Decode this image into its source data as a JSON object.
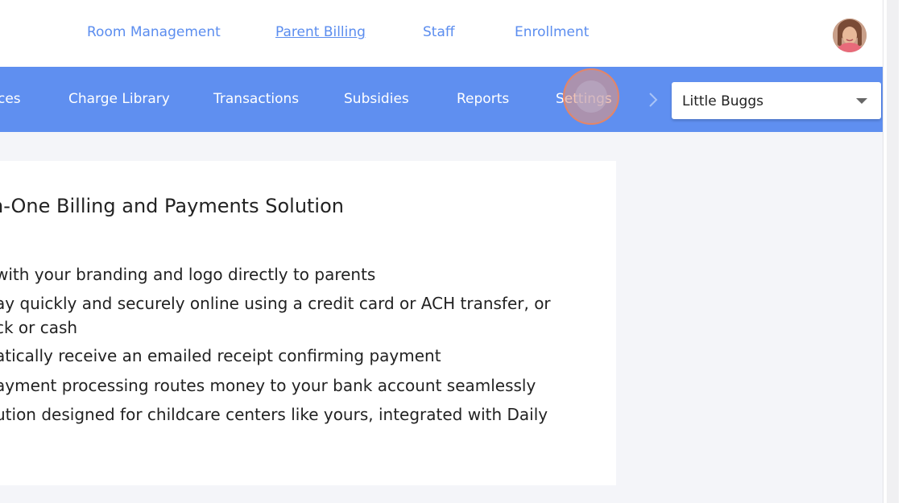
{
  "top_nav": {
    "items": [
      {
        "label": "Room Management",
        "active": false
      },
      {
        "label": "Parent Billing",
        "active": true
      },
      {
        "label": "Staff",
        "active": false
      },
      {
        "label": "Enrollment",
        "active": false
      }
    ]
  },
  "sub_nav": {
    "items": [
      {
        "label": "ces"
      },
      {
        "label": "Charge Library"
      },
      {
        "label": "Transactions"
      },
      {
        "label": "Subsidies"
      },
      {
        "label": "Reports"
      },
      {
        "label": "Settings"
      }
    ],
    "center_selector": {
      "value": "Little Buggs"
    }
  },
  "card": {
    "title": "l-in-One Billing and Payments Solution",
    "features": [
      " with your branding and logo directly to parents",
      "ay quickly and securely online using a credit card or ACH transfer, or",
      "ck or cash",
      "atically receive an emailed receipt confirming payment",
      "ayment processing routes money to your bank account seamlessly",
      "ution designed for childcare centers like yours, integrated with Daily"
    ]
  },
  "colors": {
    "nav_link": "#5b8def",
    "subnav_bg": "#5f8ff0",
    "page_bg": "#f4f5f9"
  },
  "icons": {
    "avatar": "user-avatar",
    "chevron": "chevron-right-icon",
    "caret": "caret-down-icon"
  }
}
